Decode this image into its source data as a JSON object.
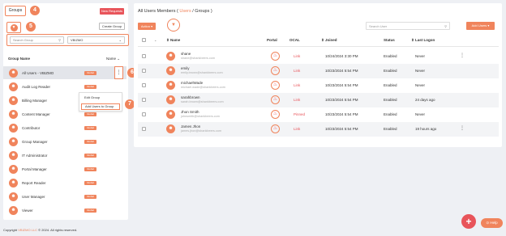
{
  "left": {
    "tab_label": "Groups",
    "new_requests_label": "New Requests",
    "create_group_label": "Create Group",
    "search_placeholder": "Search Group",
    "select_value": "VBIZMO",
    "col_group_name": "Group Name",
    "col_name": "Name",
    "groups": [
      {
        "label": "All Users - VBIZMO",
        "badge": "Global"
      },
      {
        "label": "Audit Log Reader",
        "badge": "Global"
      },
      {
        "label": "Billing Manager",
        "badge": "Global"
      },
      {
        "label": "Content Manager",
        "badge": "Global"
      },
      {
        "label": "Contributor",
        "badge": "Global"
      },
      {
        "label": "Group Manager",
        "badge": "Global"
      },
      {
        "label": "IT Administrator",
        "badge": "Global"
      },
      {
        "label": "Portal Manager",
        "badge": "Global"
      },
      {
        "label": "Report Reader",
        "badge": "Global"
      },
      {
        "label": "User Manager",
        "badge": "Global"
      },
      {
        "label": "Viewer",
        "badge": "Global"
      }
    ],
    "context_menu": {
      "edit": "Edit Group",
      "add": "Add Users to Group"
    }
  },
  "callouts": {
    "c4": "4",
    "c5": "5",
    "c6": "6",
    "c7": "7"
  },
  "right": {
    "title_prefix": "All Users Members ( ",
    "title_accent": "Users",
    "title_suffix": " / Groups )",
    "action_label": "Action ▾",
    "search_placeholder": "Search User",
    "add_users_label": "Add Users ▾",
    "headers": {
      "name": "Name",
      "portal": "Portal",
      "ocal": "OCAL",
      "joined": "Joined",
      "status": "Status",
      "last_logon": "Last Logon"
    },
    "rows": [
      {
        "name": "shane",
        "email": "shane@shankbeers.com",
        "ocal": "Link",
        "joined": "10/24/2024 3:30 PM",
        "status": "Enabled",
        "last_logon": "Never",
        "menu": "⋮"
      },
      {
        "name": "emily",
        "email": "emily.brown@shankbeers.com",
        "ocal": "Link",
        "joined": "10/23/2024 5:54 PM",
        "status": "Enabled",
        "last_logon": "Never",
        "menu": ""
      },
      {
        "name": "michaelWade",
        "email": "michael.wade@shankbeers.com",
        "ocal": "Link",
        "joined": "10/23/2024 5:54 PM",
        "status": "Enabled",
        "last_logon": "Never",
        "menu": ""
      },
      {
        "name": "sarahbrown",
        "email": "sarah.brown@shankbeers.com",
        "ocal": "Link",
        "joined": "10/23/2024 5:54 PM",
        "status": "Enabled",
        "last_logon": "24 days ago",
        "menu": ""
      },
      {
        "name": "Jhon Smith",
        "email": "johnsmith@shankbeers.com",
        "ocal": "Pinned",
        "joined": "10/23/2024 5:54 PM",
        "status": "Enabled",
        "last_logon": "Never",
        "menu": ""
      },
      {
        "name": "James Jhon",
        "email": "james.jhon@shankbeers.com",
        "ocal": "Link",
        "joined": "10/23/2024 5:54 PM",
        "status": "Enabled",
        "last_logon": "19 hours ago",
        "menu": "⋮"
      }
    ]
  },
  "footer": {
    "prefix": "Copyright ",
    "accent": "VBIZMO LLC",
    "suffix": " © 2024. All rights reserved."
  },
  "help_label": "Help",
  "fab_label": "+"
}
